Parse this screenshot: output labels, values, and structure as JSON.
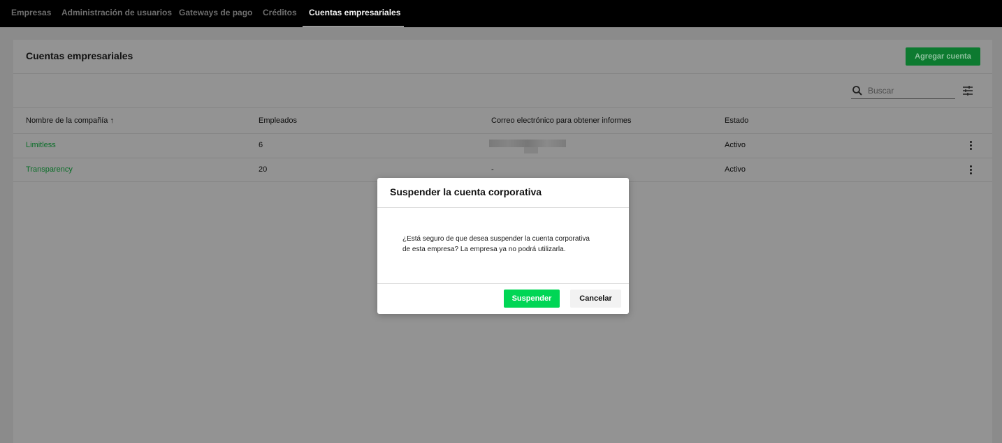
{
  "nav": {
    "tabs": [
      {
        "label": "Empresas"
      },
      {
        "label": "Administración de usuarios"
      },
      {
        "label": "Gateways de pago"
      },
      {
        "label": "Créditos"
      },
      {
        "label": "Cuentas empresariales"
      }
    ],
    "active_tab": "Cuentas empresariales"
  },
  "page": {
    "title": "Cuentas empresariales",
    "add_button_label": "Agregar cuenta"
  },
  "search": {
    "placeholder": "Buscar",
    "icon": "search-icon"
  },
  "filter": {
    "icon": "tune-icon"
  },
  "table": {
    "headers": [
      "Nombre de la compañía",
      "Empleados",
      "Correo electrónico para obtener informes",
      "Estado"
    ],
    "sort_arrow": "↑",
    "rows": [
      {
        "company": "Limitless",
        "employees": "6",
        "email": "",
        "status": "Activo"
      },
      {
        "company": "Transparency",
        "employees": "20",
        "email": "-",
        "status": "Activo"
      }
    ]
  },
  "modal": {
    "title": "Suspender la cuenta corporativa",
    "body_line1": "¿Está seguro de que desea suspender la cuenta corporativa",
    "body_line2": "de esta empresa? La empresa ya no podrá utilizarla.",
    "confirm_label": "Suspender",
    "cancel_label": "Cancelar"
  },
  "colors": {
    "accent": "#00d655",
    "link": "#0a6e28",
    "nav_bg": "#000000"
  }
}
